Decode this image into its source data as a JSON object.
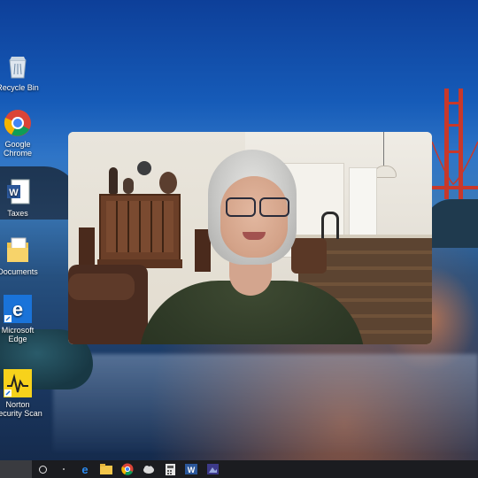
{
  "desktop_icons": [
    {
      "name": "recycle-bin",
      "label": "Recycle Bin"
    },
    {
      "name": "google-chrome",
      "label": "Google\nChrome"
    },
    {
      "name": "taxes",
      "label": "Taxes"
    },
    {
      "name": "documents",
      "label": "Documents"
    },
    {
      "name": "microsoft-edge",
      "label": "Microsoft\nEdge"
    },
    {
      "name": "norton-security-scan",
      "label": "Norton\nSecurity Scan"
    }
  ],
  "taskbar": {
    "items": [
      "search-icon",
      "task-view-icon",
      "edge-icon",
      "file-explorer-icon",
      "chrome-icon",
      "cloud-icon",
      "calculator-icon",
      "word-icon",
      "video-app-icon"
    ]
  },
  "colors": {
    "taskbar": "#1b1c20",
    "wallpaper_top": "#0d3f99",
    "bridge": "#c8382a"
  }
}
